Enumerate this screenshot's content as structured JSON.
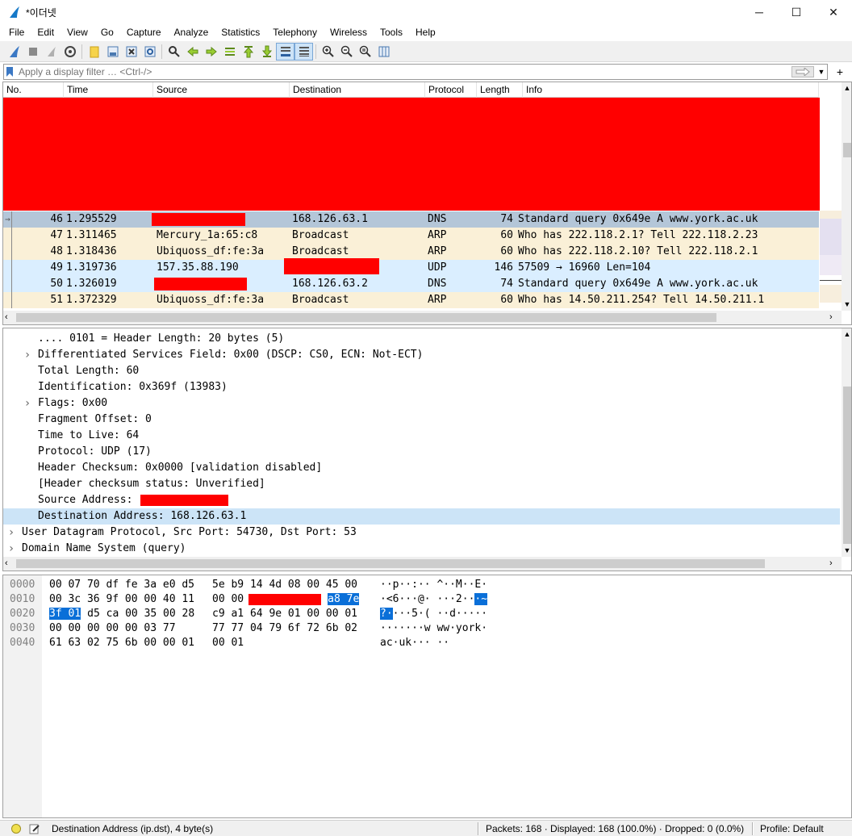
{
  "window": {
    "title": "*이더넷",
    "minimize": "─",
    "maximize": "☐",
    "close": "✕"
  },
  "menu": [
    "File",
    "Edit",
    "View",
    "Go",
    "Capture",
    "Analyze",
    "Statistics",
    "Telephony",
    "Wireless",
    "Tools",
    "Help"
  ],
  "filter": {
    "placeholder": "Apply a display filter … <Ctrl-/>",
    "value": ""
  },
  "columns": [
    "No.",
    "Time",
    "Source",
    "Destination",
    "Protocol",
    "Length",
    "Info"
  ],
  "packets": [
    {
      "no": "46",
      "time": "1.295529",
      "source": "",
      "source_redacted": true,
      "destination": "168.126.63.1",
      "dest_redacted": false,
      "protocol": "DNS",
      "length": "74",
      "info": "Standard query 0x649e A www.york.ac.uk",
      "bg": "#b4c6d8",
      "selected": true
    },
    {
      "no": "47",
      "time": "1.311465",
      "source": "Mercury_1a:65:c8",
      "source_redacted": false,
      "destination": "Broadcast",
      "dest_redacted": false,
      "protocol": "ARP",
      "length": "60",
      "info": "Who has 222.118.2.1? Tell 222.118.2.23",
      "bg": "#faf0d7"
    },
    {
      "no": "48",
      "time": "1.318436",
      "source": "Ubiquoss_df:fe:3a",
      "source_redacted": false,
      "destination": "Broadcast",
      "dest_redacted": false,
      "protocol": "ARP",
      "length": "60",
      "info": "Who has 222.118.2.10? Tell 222.118.2.1",
      "bg": "#faf0d7"
    },
    {
      "no": "49",
      "time": "1.319736",
      "source": "157.35.88.190",
      "source_redacted": false,
      "destination": "",
      "dest_redacted": true,
      "protocol": "UDP",
      "length": "146",
      "info": "57509 → 16960 Len=104",
      "bg": "#daeeff"
    },
    {
      "no": "50",
      "time": "1.326019",
      "source": "",
      "source_redacted": true,
      "destination": "168.126.63.2",
      "dest_redacted": false,
      "protocol": "DNS",
      "length": "74",
      "info": "Standard query 0x649e A www.york.ac.uk",
      "bg": "#daeeff"
    },
    {
      "no": "51",
      "time": "1.372329",
      "source": "Ubiquoss_df:fe:3a",
      "source_redacted": false,
      "destination": "Broadcast",
      "dest_redacted": false,
      "protocol": "ARP",
      "length": "60",
      "info": "Who has 14.50.211.254? Tell 14.50.211.1",
      "bg": "#faf0d7"
    }
  ],
  "details": [
    {
      "indent": 2,
      "expander": false,
      "text": ".... 0101 = Header Length: 20 bytes (5)"
    },
    {
      "indent": 2,
      "expander": true,
      "text": "Differentiated Services Field: 0x00 (DSCP: CS0, ECN: Not-ECT)"
    },
    {
      "indent": 2,
      "expander": false,
      "text": "Total Length: 60"
    },
    {
      "indent": 2,
      "expander": false,
      "text": "Identification: 0x369f (13983)"
    },
    {
      "indent": 2,
      "expander": true,
      "text": "Flags: 0x00"
    },
    {
      "indent": 2,
      "expander": false,
      "text": "Fragment Offset: 0"
    },
    {
      "indent": 2,
      "expander": false,
      "text": "Time to Live: 64"
    },
    {
      "indent": 2,
      "expander": false,
      "text": "Protocol: UDP (17)"
    },
    {
      "indent": 2,
      "expander": false,
      "text": "Header Checksum: 0x0000 [validation disabled]"
    },
    {
      "indent": 2,
      "expander": false,
      "text": "[Header checksum status: Unverified]"
    },
    {
      "indent": 2,
      "expander": false,
      "text": "Source Address: ",
      "redacted_suffix": true
    },
    {
      "indent": 2,
      "expander": false,
      "text": "Destination Address: 168.126.63.1",
      "selected": true
    },
    {
      "indent": 1,
      "expander": true,
      "text": "User Datagram Protocol, Src Port: 54730, Dst Port: 53"
    },
    {
      "indent": 1,
      "expander": true,
      "text": "Domain Name System (query)"
    }
  ],
  "bytes": [
    {
      "offset": "0000",
      "hex_a": "00 07 70 df fe 3a e0 d5",
      "hex_b": "5e b9 14 4d 08 00 45 00",
      "ascii": "··p··:·· ^··M··E·"
    },
    {
      "offset": "0010",
      "hex_a": "00 3c 36 9f 00 00 40 11",
      "hex_b": "00 00",
      "hex_b_hl": "a8 7e",
      "ascii": "·<6···@· ···2··",
      "ascii_hl": "·~"
    },
    {
      "offset": "0020",
      "hex_a_hl": "3f 01",
      "hex_a": "d5 ca 00 35 00 28",
      "hex_b": "c9 a1 64 9e 01 00 00 01",
      "ascii_hl": "?·",
      "ascii": "···5·( ··d·····"
    },
    {
      "offset": "0030",
      "hex_a": "00 00 00 00 00 03 77",
      "hex_b": "77 77 04 79 6f 72 6b 02",
      "ascii": "·······w ww·york·"
    },
    {
      "offset": "0040",
      "hex_a": "61 63 02 75 6b 00 00 01",
      "hex_b": "00 01",
      "ascii": "ac·uk··· ··"
    }
  ],
  "status": {
    "field": "Destination Address (ip.dst), 4 byte(s)",
    "packets": "Packets: 168 · Displayed: 168 (100.0%) · Dropped: 0 (0.0%)",
    "profile": "Profile: Default"
  },
  "colors": {
    "redaction": "#ff0000",
    "selection": "#cce4f7",
    "byte_highlight": "#0a6fd8"
  }
}
